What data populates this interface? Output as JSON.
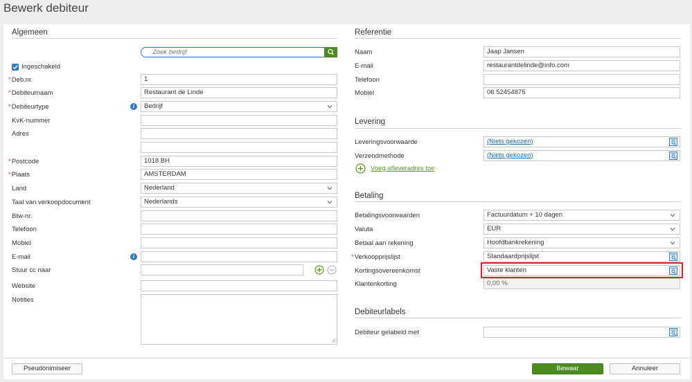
{
  "page": {
    "title": "Bewerk debiteur"
  },
  "colors": {
    "accent_green": "#4b8b1f",
    "link_blue": "#1a6cb0",
    "required_red": "#c0392b",
    "highlight_red": "#d9262b",
    "info_blue": "#2e7bc4"
  },
  "general": {
    "title": "Algemeen",
    "search_placeholder": "Zoek bedrijf",
    "enabled_label": "Ingeschakeld",
    "deb_nr": {
      "label": "Deb.nr.",
      "value": "1"
    },
    "name": {
      "label": "Debiteurnaam",
      "value": "Restaurant de Linde"
    },
    "type": {
      "label": "Debiteurtype",
      "value": "Bedrijf"
    },
    "kvk": {
      "label": "KvK-nummer",
      "value": ""
    },
    "address": {
      "label": "Adres",
      "line1": "",
      "line2": ""
    },
    "postcode": {
      "label": "Postcode",
      "value": "1018 BH"
    },
    "city": {
      "label": "Plaats",
      "value": "AMSTERDAM"
    },
    "country": {
      "label": "Land",
      "value": "Nederland"
    },
    "language": {
      "label": "Taal van verkoopdocument",
      "value": "Nederlands"
    },
    "vat": {
      "label": "Btw-nr.",
      "value": ""
    },
    "phone": {
      "label": "Telefoon",
      "value": ""
    },
    "mobile": {
      "label": "Mobiel",
      "value": ""
    },
    "email": {
      "label": "E-mail",
      "value": ""
    },
    "cc": {
      "label": "Stuur cc naar",
      "value": ""
    },
    "website": {
      "label": "Website",
      "value": ""
    },
    "notes": {
      "label": "Notities",
      "value": ""
    }
  },
  "reference": {
    "title": "Referentie",
    "name": {
      "label": "Naam",
      "value": "Jaap Jansen"
    },
    "email": {
      "label": "E-mail",
      "value": "restaurantdelinde@info.com"
    },
    "phone": {
      "label": "Telefoon",
      "value": ""
    },
    "mobile": {
      "label": "Mobiel",
      "value": "06 52454875"
    }
  },
  "delivery": {
    "title": "Levering",
    "terms": {
      "label": "Leveringsvoorwaarde",
      "value": "(Niets gekozen)"
    },
    "method": {
      "label": "Verzendmethode",
      "value": "(Niets gekozen)"
    },
    "add_address": "Voeg afleveradres toe"
  },
  "payment": {
    "title": "Betaling",
    "terms": {
      "label": "Betalingsvoorwaarden",
      "value": "Factuurdatum + 10 dagen"
    },
    "currency": {
      "label": "Valuta",
      "value": "EUR"
    },
    "account": {
      "label": "Betaal aan rekening",
      "value": "Hoofdbankrekening"
    },
    "price_list": {
      "label": "Verkoopprijslijst",
      "value": "Standaardprijslijst"
    },
    "discount_agreement": {
      "label": "Kortingsovereenkomst",
      "value": "Vaste klanten"
    },
    "customer_discount": {
      "label": "Klantenkorting",
      "value": "0,00 %"
    }
  },
  "labels": {
    "title": "Debiteurlabels",
    "tagged": {
      "label": "Debiteur gelabeld met",
      "value": ""
    }
  },
  "footer": {
    "pseudonymize": "Pseudonimiseer",
    "save": "Bewaar",
    "cancel": "Annuleer"
  }
}
